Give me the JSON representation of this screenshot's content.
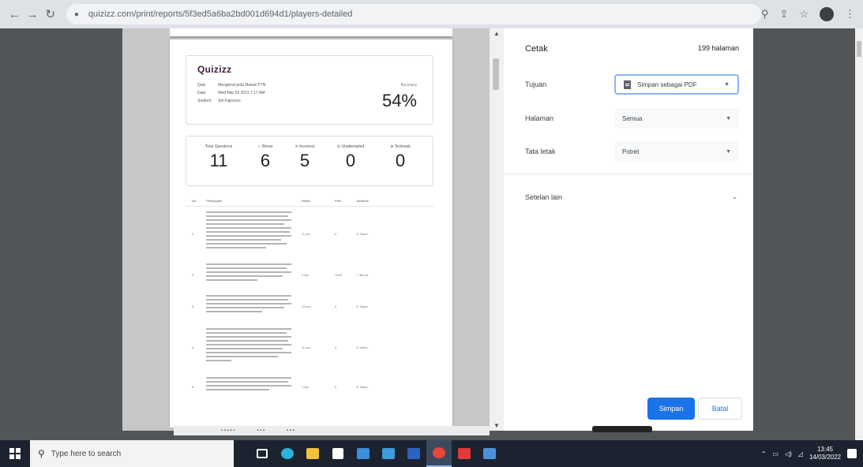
{
  "browser": {
    "url": "quizizz.com/print/reports/5f3ed5a6ba2bd001d694d1/players-detailed",
    "back_icon": "arrow-left-icon",
    "forward_icon": "arrow-right-icon",
    "reload_icon": "reload-icon"
  },
  "report": {
    "logo": "Quizizz",
    "quiz_label": "Quiz",
    "quiz_value": "Mengenal pola Masuk PTN",
    "date_label": "Date",
    "date_value": "Wed Mar 03 2021 7:17 AM",
    "student_label": "Student",
    "student_value": "Siti Fujisuryo",
    "accuracy_label": "Accuracy",
    "accuracy_value": "54%",
    "stats": [
      {
        "label": "Total Questions",
        "value": "11"
      },
      {
        "label": "✓ Benar",
        "value": "6"
      },
      {
        "label": "✕ Incorrect",
        "value": "5"
      },
      {
        "label": "⊘ Unattempted",
        "value": "0"
      },
      {
        "label": "⊘ Terlewati",
        "value": "0"
      }
    ],
    "table_headers": [
      "No",
      "Pertanyaan",
      "Waktu",
      "Poin",
      "Jawaban"
    ],
    "rows": [
      {
        "no": "1",
        "time": "11 sec",
        "points": "0",
        "answer": "✕ Salah"
      },
      {
        "no": "2",
        "time": "9 sec",
        "points": "1440",
        "answer": "✓ Benar"
      },
      {
        "no": "3",
        "time": "13 sec",
        "points": "0",
        "answer": "✕ Salah"
      },
      {
        "no": "4",
        "time": "11 sec",
        "points": "0",
        "answer": "✕ Salah"
      },
      {
        "no": "5",
        "time": "1 sec",
        "points": "0",
        "answer": "✕ Salah"
      }
    ]
  },
  "dialog": {
    "title": "Cetak",
    "pages_count": "199 halaman",
    "destination_label": "Tujuan",
    "destination_value": "Simpan sebagai PDF",
    "pages_label": "Halaman",
    "pages_value": "Semua",
    "layout_label": "Tata letak",
    "layout_value": "Potret",
    "more_settings": "Setelan lain",
    "save_button": "Simpan",
    "cancel_button": "Batal"
  },
  "taskbar": {
    "search_placeholder": "Type here to search",
    "time": "13:45",
    "date": "14/03/2022"
  },
  "colors": {
    "primary_button": "#1a73e8",
    "taskbar": "#1c2330"
  }
}
